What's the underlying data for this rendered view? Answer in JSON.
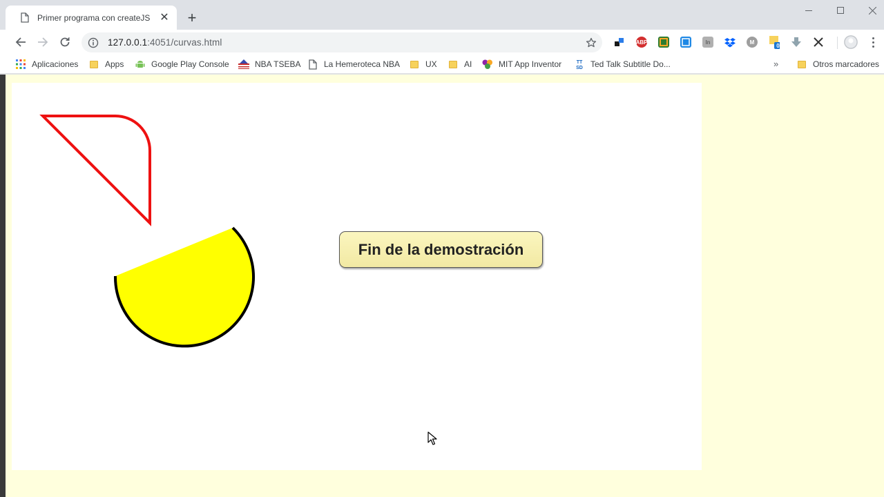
{
  "browser": {
    "tab": {
      "title": "Primer programa con createJS",
      "close_glyph": "✕",
      "icon": "page-icon"
    },
    "new_tab_glyph": "+",
    "address": {
      "host": "127.0.0.1",
      "path": ":4051/curvas.html",
      "icon": "info-icon"
    },
    "extensions": [
      "dropbox-like-icon",
      "adblock-plus-icon",
      "extension-green-icon",
      "extension-blue-icon",
      "extension-gray-icon",
      "dropbox-icon",
      "extension-circle-icon",
      "notes-icon",
      "download-icon",
      "x-icon"
    ],
    "extension_badge": "0",
    "bookmarks": [
      {
        "label": "Aplicaciones",
        "icon": "apps-grid-icon"
      },
      {
        "label": "Apps",
        "icon": "folder-icon"
      },
      {
        "label": "Google Play Console",
        "icon": "android-icon"
      },
      {
        "label": "NBA TSEBA",
        "icon": "nba-icon"
      },
      {
        "label": "La Hemeroteca NBA",
        "icon": "page-icon"
      },
      {
        "label": "UX",
        "icon": "folder-icon"
      },
      {
        "label": "AI",
        "icon": "folder-icon"
      },
      {
        "label": "MIT App Inventor",
        "icon": "app-inventor-icon"
      },
      {
        "label": "Ted Talk Subtitle Do...",
        "icon": "ttsd-icon"
      }
    ],
    "bookmarks_overflow": "»",
    "other_bookmarks": "Otros marcadores",
    "ttsd_text": "TT SD"
  },
  "page": {
    "button_label": "Fin de la demostración",
    "colors": {
      "page_bg": "#ffffdd",
      "canvas_bg": "#ffffff",
      "triangle_stroke": "#ee1111",
      "semicircle_fill": "#ffff00",
      "semicircle_stroke": "#000000"
    }
  }
}
